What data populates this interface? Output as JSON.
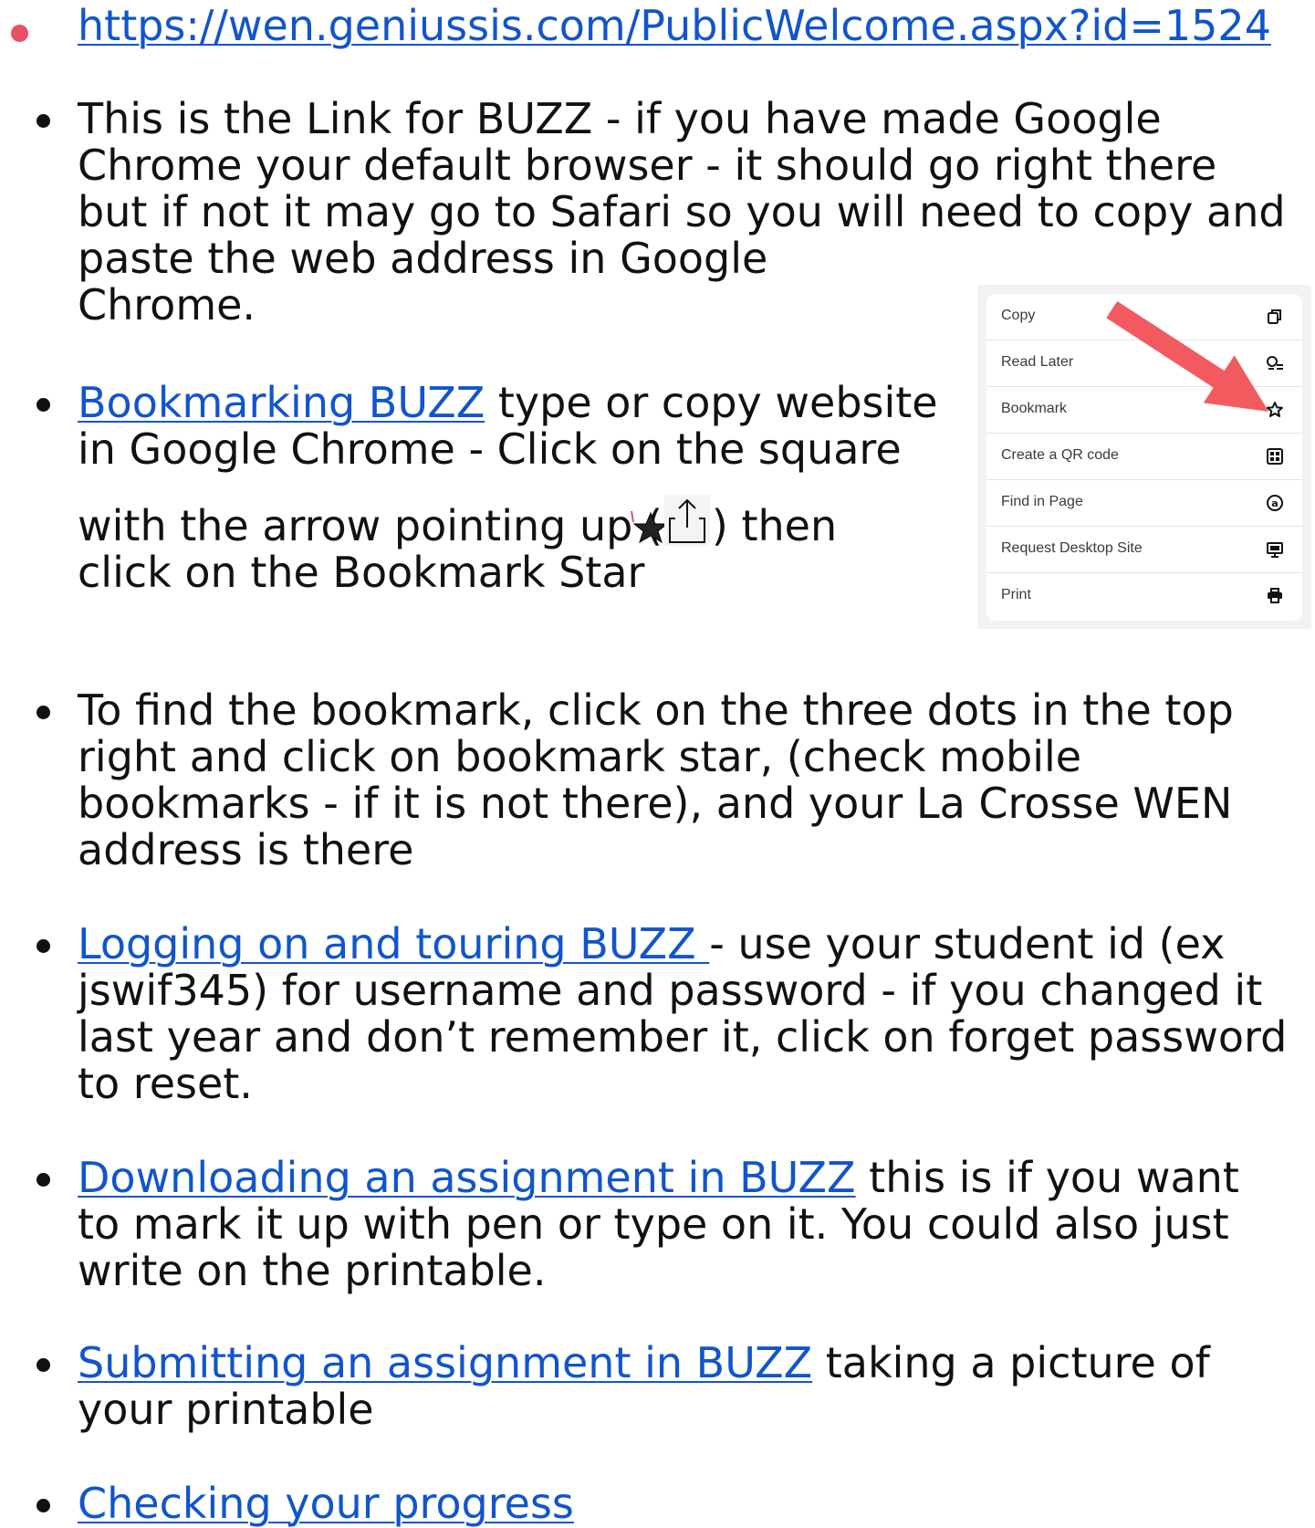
{
  "bullets": [
    {
      "link": "https://wen.geniussis.com/PublicWelcome.aspx?id=1524",
      "text": ""
    },
    {
      "line1": "This is the Link for BUZZ - if you have made Google",
      "line2": "Chrome your default browser - it should go right there",
      "line3": "but if not it may go to Safari so you will need to copy and",
      "line4": "paste the web address in Google",
      "line5": "Chrome."
    },
    {
      "link": "Bookmarking BUZZ",
      "line1_rest": " type or copy website",
      "line2": "in Google Chrome - Click on the square",
      "line3_pre": "with the arrow pointing up (",
      "line3_post": ") then",
      "line4": "click on the Bookmark Star"
    },
    {
      "line1": "To find the bookmark, click on the three dots in the top",
      "line2": "right and click on bookmark star, (check mobile",
      "line3": "bookmarks - if it is not there), and your La Crosse WEN",
      "line4": "address is there"
    },
    {
      "link": "Logging on and touring BUZZ ",
      "line1_rest": "- use your student id (ex",
      "line2": "jswif345) for username and password - if you changed it",
      "line3": "last year and don’t remember it, click on forget password",
      "line4": "to reset."
    },
    {
      "link": "Downloading an assignment in BUZZ",
      "line1_rest": " this is if you want",
      "line2": "to mark it up with pen or type on it.  You could also just",
      "line3": "write on the printable."
    },
    {
      "link": "Submitting an assignment in BUZZ",
      "line1_rest": " taking a picture of",
      "line2": "your printable"
    },
    {
      "link": "Checking your progress"
    }
  ],
  "menu": {
    "items": [
      {
        "label": "Copy",
        "icon": "copy-icon"
      },
      {
        "label": "Read Later",
        "icon": "read-later-icon"
      },
      {
        "label": "Bookmark",
        "icon": "star-icon"
      },
      {
        "label": "Create a QR code",
        "icon": "qr-code-icon"
      },
      {
        "label": "Find in Page",
        "icon": "find-in-page-icon"
      },
      {
        "label": "Request Desktop Site",
        "icon": "desktop-icon"
      },
      {
        "label": "Print",
        "icon": "print-icon"
      }
    ]
  },
  "colors": {
    "link": "#1155cc",
    "text": "#111111",
    "pink_bullet": "#e8506a",
    "arrow": "#f25a5f"
  }
}
